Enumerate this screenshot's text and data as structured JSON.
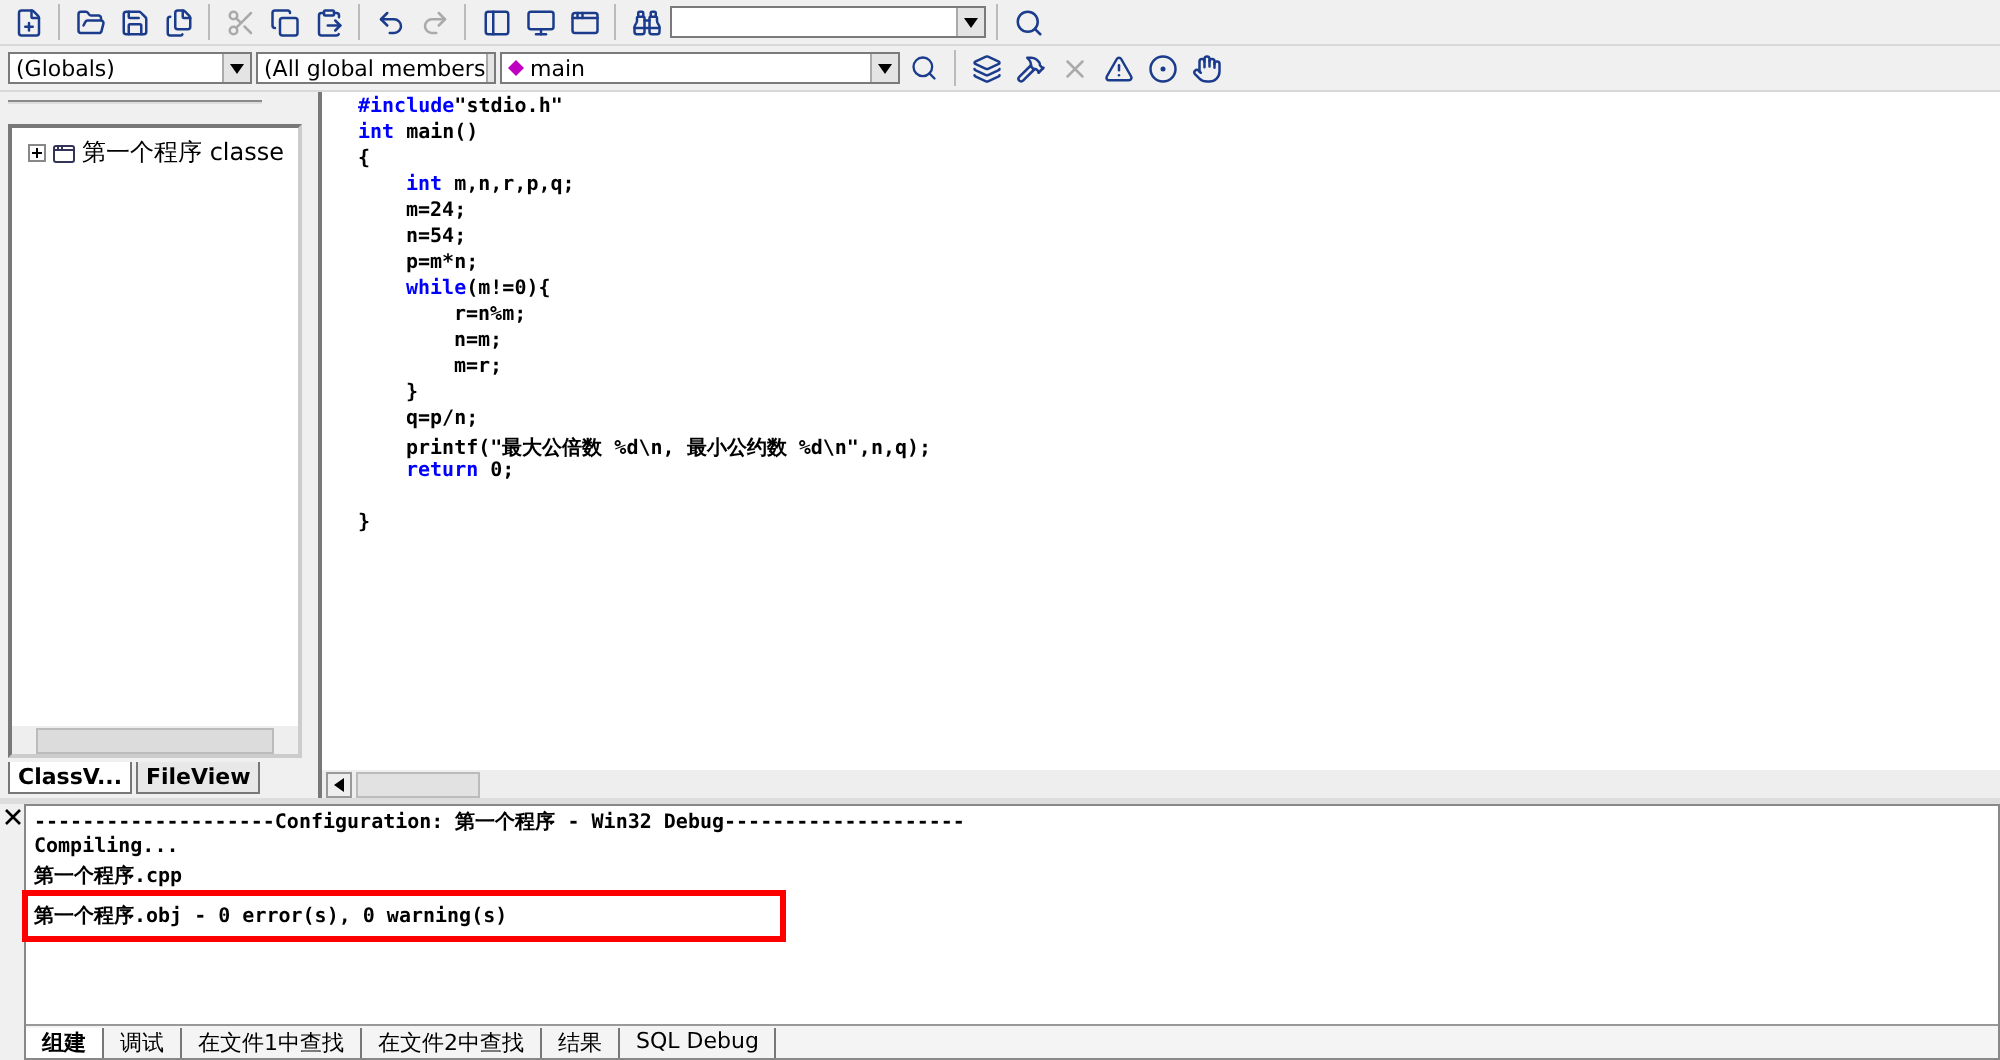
{
  "toolbar": {
    "buttons": [
      {
        "kind": "new",
        "disabled": false
      },
      {
        "kind": "open",
        "disabled": false
      },
      {
        "kind": "save",
        "disabled": false
      },
      {
        "kind": "saveall",
        "disabled": false
      },
      {
        "kind": "cut",
        "disabled": true
      },
      {
        "kind": "copy",
        "disabled": false
      },
      {
        "kind": "paste",
        "disabled": false
      },
      {
        "kind": "undo",
        "disabled": false
      },
      {
        "kind": "redo",
        "disabled": true
      },
      {
        "kind": "workspace",
        "disabled": false
      },
      {
        "kind": "output",
        "disabled": false
      },
      {
        "kind": "windows",
        "disabled": false
      },
      {
        "kind": "findfiles",
        "disabled": false
      }
    ],
    "find_button": {
      "kind": "find",
      "disabled": false
    }
  },
  "wizard_bar": {
    "scope": "(Globals)",
    "members": "(All global members",
    "function": "main"
  },
  "build_toolbar": {
    "buttons": [
      {
        "kind": "compile",
        "disabled": false
      },
      {
        "kind": "build",
        "disabled": false
      },
      {
        "kind": "stop",
        "disabled": true
      },
      {
        "kind": "execute",
        "disabled": false
      },
      {
        "kind": "breakpoint",
        "disabled": false
      },
      {
        "kind": "go",
        "disabled": false
      }
    ]
  },
  "workspace": {
    "tree": [
      {
        "label": "第一个程序 classe",
        "expanded": false
      }
    ],
    "tabs": [
      {
        "label": "ClassV...",
        "selected": true
      },
      {
        "label": "FileView",
        "selected": false
      }
    ]
  },
  "editor": {
    "lines": [
      {
        "segments": [
          {
            "kind": "keyword",
            "text": "#include"
          },
          {
            "kind": "plain",
            "text": "\"stdio.h\""
          }
        ]
      },
      {
        "segments": [
          {
            "kind": "keyword",
            "text": "int"
          },
          {
            "kind": "plain",
            "text": " main()"
          }
        ]
      },
      {
        "segments": [
          {
            "kind": "plain",
            "text": "{"
          }
        ],
        "children": [
          {
            "segments": [
              {
                "kind": "keyword",
                "text": "int"
              },
              {
                "kind": "plain",
                "text": " m,n,r,p,q;"
              }
            ]
          },
          {
            "segments": [
              {
                "kind": "plain",
                "text": "m=24;"
              }
            ]
          },
          {
            "segments": [
              {
                "kind": "plain",
                "text": "n=54;"
              }
            ]
          },
          {
            "segments": [
              {
                "kind": "plain",
                "text": "p=m*n;"
              }
            ]
          },
          {
            "segments": [
              {
                "kind": "keyword",
                "text": "while"
              },
              {
                "kind": "plain",
                "text": "(m!=0){"
              }
            ],
            "children": [
              {
                "segments": [
                  {
                    "kind": "plain",
                    "text": "r=n%m;"
                  }
                ]
              },
              {
                "segments": [
                  {
                    "kind": "plain",
                    "text": "n=m;"
                  }
                ]
              },
              {
                "segments": [
                  {
                    "kind": "plain",
                    "text": "m=r;"
                  }
                ]
              }
            ]
          },
          {
            "segments": [
              {
                "kind": "plain",
                "text": "}"
              }
            ]
          },
          {
            "segments": [
              {
                "kind": "plain",
                "text": "q=p/n;"
              }
            ]
          },
          {
            "segments": [
              {
                "kind": "plain",
                "text": "printf(\"最大公倍数 %d\\n, 最小公约数 %d\\n\",n,q);"
              }
            ]
          },
          {
            "segments": [
              {
                "kind": "keyword",
                "text": "return"
              },
              {
                "kind": "plain",
                "text": " 0;"
              }
            ],
            "blank_after": true
          }
        ]
      },
      {
        "segments": [
          {
            "kind": "plain",
            "text": "}"
          }
        ]
      }
    ]
  },
  "output": {
    "lines": [
      {
        "text": "--------------------Configuration: 第一个程序 - Win32 Debug--------------------",
        "highlighted": false
      },
      {
        "text": "Compiling...",
        "highlighted": false
      },
      {
        "text": "第一个程序.cpp",
        "highlighted": false
      },
      {
        "text": "第一个程序.obj - 0 error(s), 0 warning(s)",
        "highlighted": true
      }
    ],
    "tabs": [
      {
        "label": "组建",
        "selected": true
      },
      {
        "label": "调试",
        "selected": false
      },
      {
        "label": "在文件1中查找",
        "selected": false
      },
      {
        "label": "在文件2中查找",
        "selected": false
      },
      {
        "label": "结果",
        "selected": false
      },
      {
        "label": "SQL Debug",
        "selected": false
      }
    ]
  }
}
